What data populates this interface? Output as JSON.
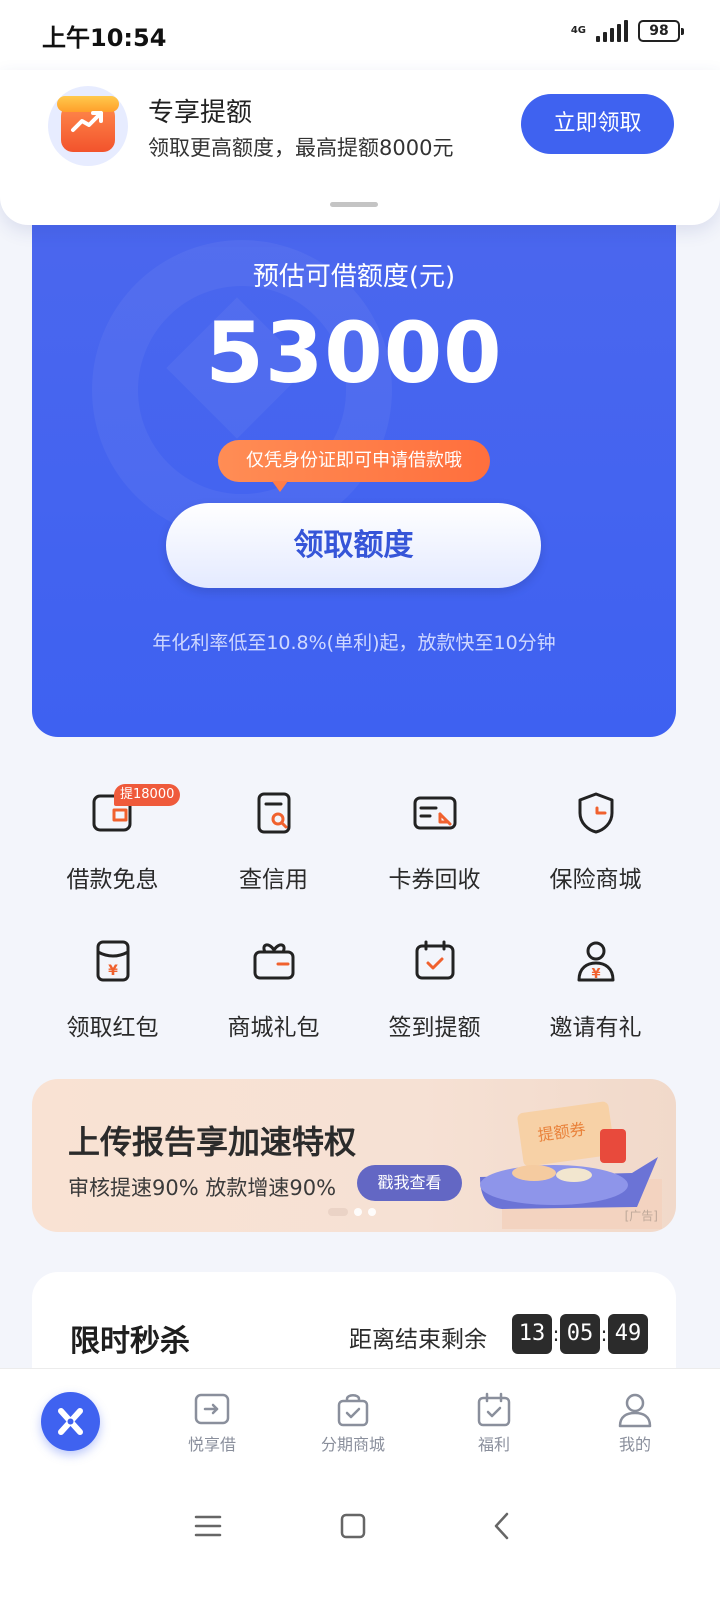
{
  "status": {
    "time": "上午10:54",
    "network": "4G",
    "battery": "98"
  },
  "promo": {
    "title": "专享提额",
    "subtitle": "领取更高额度，最高提额8000元",
    "button": "立即领取"
  },
  "hero": {
    "label": "预估可借额度(元)",
    "amount": "53000",
    "tip": "仅凭身份证即可申请借款哦",
    "button": "领取额度",
    "note": "年化利率低至10.8%(单利)起，放款快至10分钟"
  },
  "grid": {
    "items": [
      {
        "label": "借款免息",
        "badge": "提18000",
        "icon": "loan-icon"
      },
      {
        "label": "查信用",
        "icon": "credit-search-icon"
      },
      {
        "label": "卡券回收",
        "icon": "card-recycle-icon"
      },
      {
        "label": "保险商城",
        "icon": "shield-icon"
      },
      {
        "label": "领取红包",
        "icon": "red-packet-icon"
      },
      {
        "label": "商城礼包",
        "icon": "gift-box-icon"
      },
      {
        "label": "签到提额",
        "icon": "calendar-check-icon"
      },
      {
        "label": "邀请有礼",
        "icon": "invite-user-icon"
      }
    ]
  },
  "ad": {
    "title": "上传报告享加速特权",
    "subtitle": "审核提速90% 放款增速90%",
    "button": "戳我查看",
    "coupon_label": "提额券",
    "tag": "[广告]"
  },
  "flash_sale": {
    "title": "限时秒杀",
    "countdown_label": "距离结束剩余",
    "hours": "13",
    "minutes": "05",
    "seconds": "49"
  },
  "tab_bar": {
    "items": [
      {
        "label": "悦享借",
        "icon": "loan-tab-icon"
      },
      {
        "label": "分期商城",
        "icon": "shopping-bag-icon"
      },
      {
        "label": "福利",
        "icon": "calendar-check-icon"
      },
      {
        "label": "我的",
        "icon": "user-icon"
      }
    ],
    "accent": "#3f62f0",
    "orange": "#f0612e"
  }
}
